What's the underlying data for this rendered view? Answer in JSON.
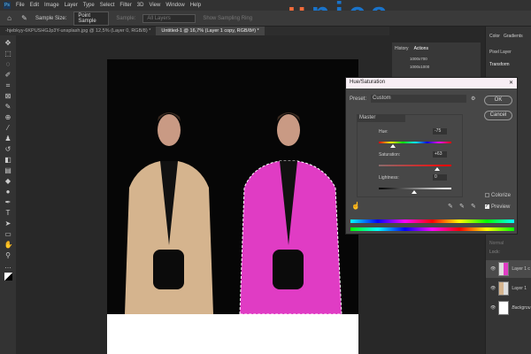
{
  "menu": [
    "File",
    "Edit",
    "Image",
    "Layer",
    "Type",
    "Select",
    "Filter",
    "3D",
    "View",
    "Window",
    "Help"
  ],
  "options": {
    "sample_size_label": "Sample Size:",
    "sample_size_value": "Point Sample",
    "sample_label": "Sample:",
    "sample_value": "All Layers",
    "show_ring": "Show Sampling Ring"
  },
  "tabs": [
    {
      "label": "-hjebkyy-6KPUSHGJp3Y-unsplash.jpg @ 12,5% (Layer 0, RGB/8) *"
    },
    {
      "label": "Untitled-1 @ 16,7% (Layer 1 copy, RGB/8#) *"
    }
  ],
  "logo": {
    "u": "u",
    "rest": "nica",
    "u_color": "#f26b3a",
    "rest_color": "#1a73c9"
  },
  "actions_panel": {
    "tabs": [
      "History",
      "Actions"
    ],
    "items": [
      "1000x700",
      "1000x1000"
    ]
  },
  "right_panel": {
    "tabs": [
      "Color",
      "Gradients"
    ],
    "pixel_layer": "Pixel Layer",
    "transform": "Transform"
  },
  "dialog": {
    "title": "Hue/Saturation",
    "preset_label": "Preset:",
    "preset_value": "Custom",
    "channel": "Master",
    "ok": "OK",
    "cancel": "Cancel",
    "hue_label": "Hue:",
    "hue": "-75",
    "saturation_label": "Saturation:",
    "saturation": "+63",
    "lightness_label": "Lightness:",
    "lightness": "0",
    "colorize": "Colorize",
    "preview": "Preview",
    "preview_checked": true,
    "colorize_checked": false
  },
  "layers": {
    "header": "Normal",
    "lock": "Lock:",
    "items": [
      "Layer 1 c",
      "Layer 1",
      "Backgrou"
    ]
  }
}
